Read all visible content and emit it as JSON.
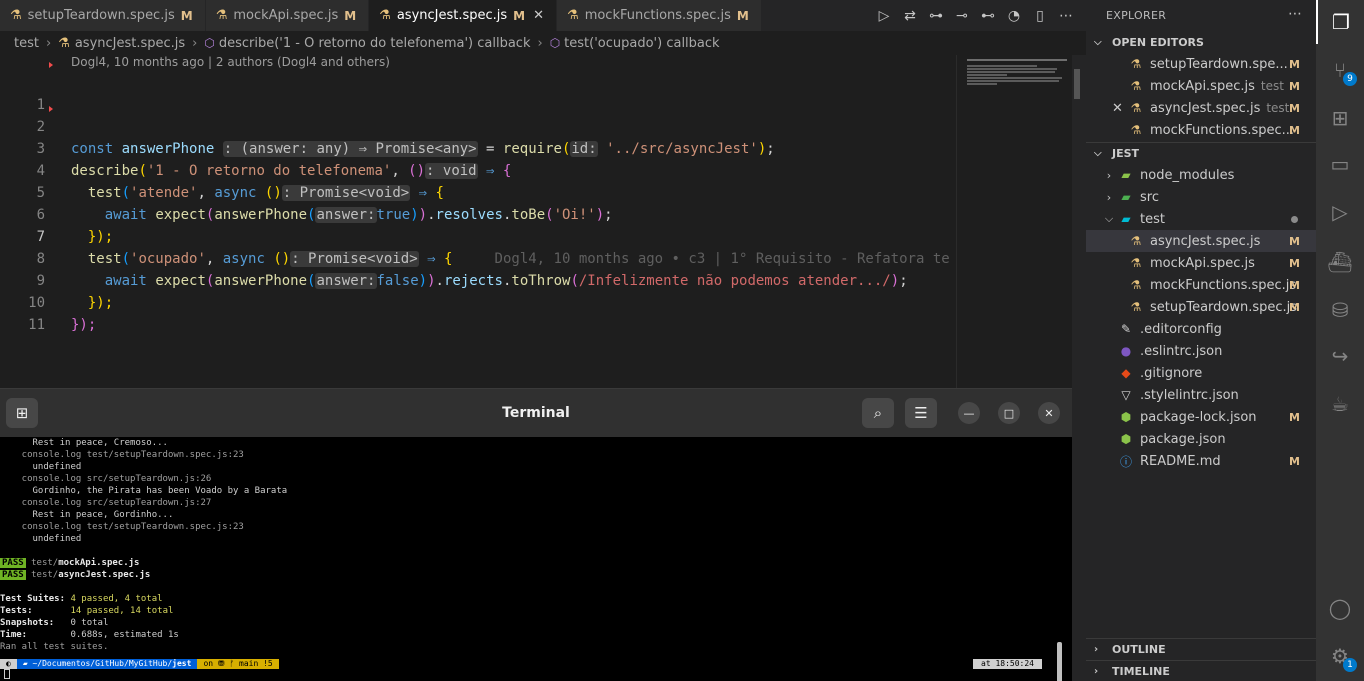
{
  "tabs": [
    {
      "name": "setupTeardown.spec.js",
      "status": "M"
    },
    {
      "name": "mockApi.spec.js",
      "status": "M"
    },
    {
      "name": "asyncJest.spec.js",
      "status": "M",
      "active": true
    },
    {
      "name": "mockFunctions.spec.js",
      "status": "M"
    }
  ],
  "breadcrumb": [
    "test",
    "asyncJest.spec.js",
    "describe('1 - O retorno do telefonema') callback",
    "test('ocupado') callback"
  ],
  "blame": "Dogl4, 10 months ago | 2 authors (Dogl4 and others)",
  "code": {
    "line_numbers": [
      "1",
      "2",
      "3",
      "4",
      "5",
      "6",
      "7",
      "8",
      "9",
      "10",
      "11"
    ],
    "l1": {
      "kw": "const",
      "var": "answerPhone",
      "hint": ": (answer: any) ⇒ Promise<any>",
      "eq": " =",
      "fn": "require",
      "hint2": "id:",
      "str": "'../src/asyncJest'",
      "end": ";"
    },
    "l3": {
      "fn": "describe",
      "str": "'1 - O retorno do telefonema'",
      "hint": ": void",
      "arrow": "⇒"
    },
    "l4": {
      "fn": "test",
      "str": "'atende'",
      "kw": "async",
      "hint": ": Promise<void>",
      "arrow": "⇒"
    },
    "l5": {
      "kw": "await",
      "fn": "expect",
      "var": "answerPhone",
      "hint": "answer:",
      "val": "true",
      "m1": "resolves",
      "m2": "toBe",
      "str": "'Oi!'"
    },
    "l6": "});",
    "l7": {
      "fn": "test",
      "str": "'ocupado'",
      "kw": "async",
      "hint": ": Promise<void>",
      "arrow": "⇒",
      "ghost": "Dogl4, 10 months ago • c3 | 1° Requisito - Refatora te"
    },
    "l8": {
      "kw": "await",
      "fn": "expect",
      "var": "answerPhone",
      "hint": "answer:",
      "val": "false",
      "m1": "rejects",
      "m2": "toThrow",
      "rx": "/Infelizmente não podemos atender.../"
    },
    "l9": "});",
    "l10": "});"
  },
  "terminal": {
    "title": "Terminal",
    "lines": [
      "      Rest in peace, Cremoso...",
      "    console.log test/setupTeardown.spec.js:23",
      "      undefined",
      "    console.log src/setupTeardown.js:26",
      "      Gordinho, the Pirata has been Voado by a Barata",
      "    console.log src/setupTeardown.js:27",
      "      Rest in peace, Gordinho...",
      "    console.log test/setupTeardown.spec.js:23",
      "      undefined"
    ],
    "pass_label": "PASS",
    "pass_files": [
      {
        "dir": "test/",
        "file": "mockApi.spec.js"
      },
      {
        "dir": "test/",
        "file": "asyncJest.spec.js"
      }
    ],
    "summary": [
      {
        "label": "Test Suites:",
        "value": "4 passed, 4 total"
      },
      {
        "label": "Tests:",
        "value": "14 passed, 14 total"
      },
      {
        "label": "Snapshots:",
        "value": "0 total"
      },
      {
        "label": "Time:",
        "value": "0.688s, estimated 1s"
      }
    ],
    "ran_all": "Ran all test suites.",
    "prompt": {
      "path_prefix": "~/Documentos/GitHub/MyGitHub/",
      "path_bold": "jest",
      "git": "on ⛃ ᚠ main !5",
      "time": "at 18:50:24"
    }
  },
  "explorer": {
    "title": "EXPLORER",
    "open_editors_label": "OPEN EDITORS",
    "open_editors": [
      {
        "name": "setupTeardown.spec.js",
        "display": "setupTeardown.spe...",
        "desc": "",
        "status": "M"
      },
      {
        "name": "mockApi.spec.js",
        "display": "mockApi.spec.js",
        "desc": "test",
        "status": "M"
      },
      {
        "name": "asyncJest.spec.js",
        "display": "asyncJest.spec.js",
        "desc": "test",
        "status": "M",
        "active": true
      },
      {
        "name": "mockFunctions.spec.js",
        "display": "mockFunctions.spec...",
        "desc": "",
        "status": "M"
      }
    ],
    "project_label": "JEST",
    "tree": [
      {
        "name": "node_modules",
        "kind": "folder",
        "depth": 0,
        "icon": "node-folder-icon",
        "color": "#8bc34a"
      },
      {
        "name": "src",
        "kind": "folder",
        "depth": 0,
        "icon": "src-folder-icon",
        "color": "#4caf50"
      },
      {
        "name": "test",
        "kind": "folder-open",
        "depth": 0,
        "icon": "test-folder-icon",
        "color": "#00bcd4",
        "dot": true
      },
      {
        "name": "asyncJest.spec.js",
        "kind": "file",
        "depth": 1,
        "icon": "flask-icon",
        "color": "#e5c07b",
        "status": "M",
        "selected": true
      },
      {
        "name": "mockApi.spec.js",
        "kind": "file",
        "depth": 1,
        "icon": "flask-icon",
        "color": "#e5c07b",
        "status": "M"
      },
      {
        "name": "mockFunctions.spec.js",
        "kind": "file",
        "depth": 1,
        "icon": "flask-icon",
        "color": "#e5c07b",
        "status": "M"
      },
      {
        "name": "setupTeardown.spec.js",
        "kind": "file",
        "depth": 1,
        "icon": "flask-icon",
        "color": "#e5c07b",
        "status": "M"
      },
      {
        "name": ".editorconfig",
        "kind": "file",
        "depth": 0,
        "icon": "editorconfig-icon",
        "color": "#d4d4d4"
      },
      {
        "name": ".eslintrc.json",
        "kind": "file",
        "depth": 0,
        "icon": "eslint-icon",
        "color": "#7e57c2"
      },
      {
        "name": ".gitignore",
        "kind": "file",
        "depth": 0,
        "icon": "git-icon",
        "color": "#e64a19"
      },
      {
        "name": ".stylelintrc.json",
        "kind": "file",
        "depth": 0,
        "icon": "stylelint-icon",
        "color": "#d4d4d4"
      },
      {
        "name": "package-lock.json",
        "kind": "file",
        "depth": 0,
        "icon": "npm-icon",
        "color": "#8bc34a",
        "status": "M"
      },
      {
        "name": "package.json",
        "kind": "file",
        "depth": 0,
        "icon": "npm-icon",
        "color": "#8bc34a"
      },
      {
        "name": "README.md",
        "kind": "file",
        "depth": 0,
        "icon": "info-icon",
        "color": "#42a5f5",
        "status": "M"
      }
    ],
    "outline_label": "OUTLINE",
    "timeline_label": "TIMELINE"
  },
  "activity_bar": {
    "source_control_badge": "9",
    "settings_badge": "1"
  },
  "colors": {
    "accent": "#007acc",
    "modified": "#e2c08d",
    "pass": "#6fb324"
  }
}
